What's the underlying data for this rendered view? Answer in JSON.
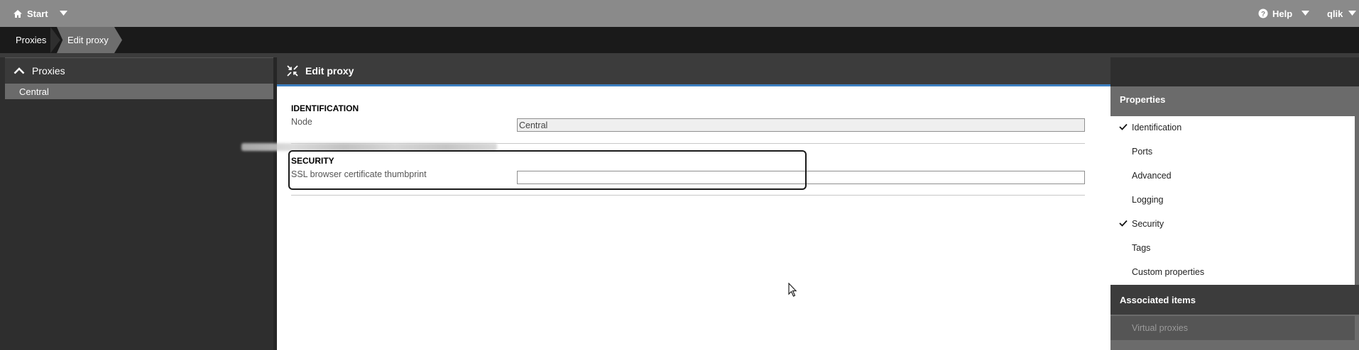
{
  "topbar": {
    "start_label": "Start",
    "help_label": "Help",
    "user_label": "qlik"
  },
  "breadcrumb": [
    "Proxies",
    "Edit proxy"
  ],
  "left_panel": {
    "title": "Proxies",
    "items": [
      "Central"
    ]
  },
  "main": {
    "title": "Edit proxy",
    "sections": {
      "identification": {
        "title": "IDENTIFICATION",
        "node_label": "Node",
        "node_value": "Central"
      },
      "security": {
        "title": "SECURITY",
        "thumbprint_label": "SSL browser certificate thumbprint",
        "thumbprint_value": ""
      }
    }
  },
  "properties": {
    "title": "Properties",
    "items": [
      {
        "label": "Identification",
        "checked": true
      },
      {
        "label": "Ports",
        "checked": false
      },
      {
        "label": "Advanced",
        "checked": false
      },
      {
        "label": "Logging",
        "checked": false
      },
      {
        "label": "Security",
        "checked": true
      },
      {
        "label": "Tags",
        "checked": false
      },
      {
        "label": "Custom properties",
        "checked": false
      }
    ]
  },
  "associated_items": {
    "title": "Associated items",
    "items": [
      "Virtual proxies"
    ]
  },
  "colors": {
    "accent": "#3d7fc1",
    "topbar": "#8a8a8a",
    "dark": "#1a1a1a"
  }
}
